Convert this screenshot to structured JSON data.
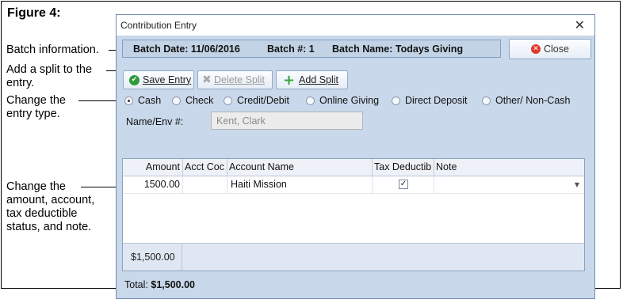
{
  "figure": {
    "title": "Figure 4:"
  },
  "callouts": [
    {
      "text_lines": [
        "Batch information."
      ]
    },
    {
      "text_lines": [
        "Add a split to the",
        "entry."
      ]
    },
    {
      "text_lines": [
        "Change the",
        "entry type."
      ]
    },
    {
      "text_lines": [
        "Change the",
        "amount, account,",
        "tax deductible",
        "status, and note."
      ]
    }
  ],
  "window": {
    "title": "Contribution Entry",
    "close_glyph": "✕",
    "batch": {
      "date": "Batch Date: 11/06/2016",
      "number": "Batch #: 1",
      "name": "Batch Name: Todays Giving"
    },
    "close_button": "Close",
    "toolbar": {
      "save_label": "Save Entry",
      "delete_label": "Delete Split",
      "add_label": "Add Split"
    },
    "entry_types": [
      {
        "label": "Cash",
        "selected": true
      },
      {
        "label": "Check",
        "selected": false
      },
      {
        "label": "Credit/Debit",
        "selected": false
      },
      {
        "label": "Online Giving",
        "selected": false
      },
      {
        "label": "Direct Deposit",
        "selected": false
      },
      {
        "label": "Other/ Non-Cash",
        "selected": false
      }
    ],
    "name_field": {
      "label": "Name/Env #:",
      "value": "Kent, Clark"
    },
    "grid": {
      "columns": [
        "Amount",
        "Acct Coc",
        "Account Name",
        "Tax Deductib",
        "Note"
      ],
      "rows": [
        {
          "amount": "1500.00",
          "acct_code": "",
          "account_name": "Haiti Mission",
          "tax_deductible": true,
          "note": ""
        }
      ],
      "footer_sum": "$1,500.00"
    },
    "total": {
      "label": "Total:",
      "value": "$1,500.00"
    }
  },
  "icons": {
    "save": "check-circle-icon",
    "delete": "delete-x-icon",
    "add": "green-plus-icon",
    "close": "red-x-circle-icon",
    "dropdown": "chevron-down-icon"
  },
  "colors": {
    "window_bg": "#c9d8ea",
    "close_icon": "#e0382b",
    "save_icon": "#2e9a3b",
    "add_icon": "#39a43b"
  }
}
